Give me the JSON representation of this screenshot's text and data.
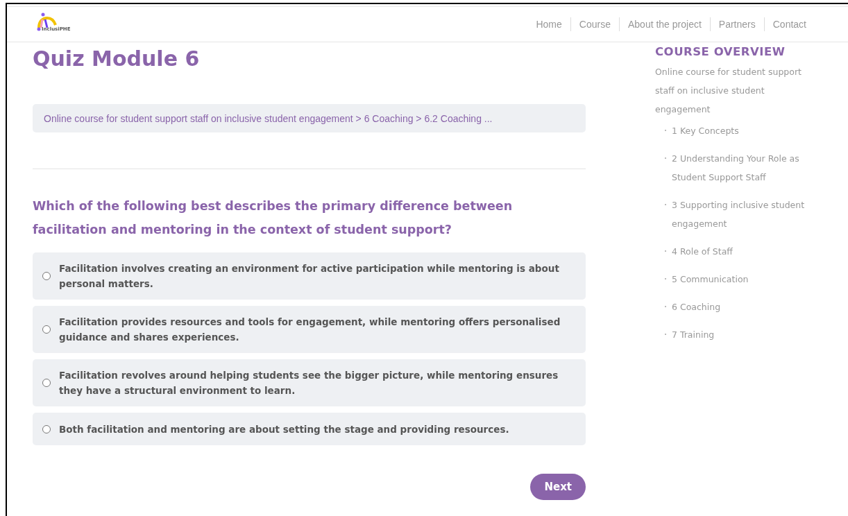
{
  "header": {
    "logo_text": "InclusiPHE",
    "nav": [
      {
        "label": "Home"
      },
      {
        "label": "Course"
      },
      {
        "label": "About the project"
      },
      {
        "label": "Partners"
      },
      {
        "label": "Contact"
      }
    ]
  },
  "title": "Quiz Module 6",
  "breadcrumb": "Online course for student support staff on inclusive student engagement > 6 Coaching  > 6.2 Coaching ...",
  "question": "Which of the following best describes the primary difference between facilitation and mentoring in the context of student support?",
  "options": [
    {
      "text": "Facilitation involves creating an environment for active participation while mentoring is about personal matters.",
      "selected": false
    },
    {
      "text": "Facilitation provides resources and tools for engagement, while mentoring offers personalised guidance and shares experiences.",
      "selected": false
    },
    {
      "text": "Facilitation revolves around helping students see the bigger picture, while mentoring ensures they have a structural environment to learn.",
      "selected": false
    },
    {
      "text": "Both facilitation and mentoring are about setting the stage and providing resources.",
      "selected": false
    }
  ],
  "next_button": "Next",
  "sidebar": {
    "heading": "COURSE OVERVIEW",
    "course": "Online course for student support staff on inclusive student engagement",
    "items": [
      {
        "label": "1 Key Concepts"
      },
      {
        "label": "2 Understanding Your Role as Student Support Staff"
      },
      {
        "label": "3 Supporting inclusive student engagement"
      },
      {
        "label": "4 Role of Staff"
      },
      {
        "label": "5 Communication"
      },
      {
        "label": "6 Coaching"
      },
      {
        "label": "7 Training"
      }
    ]
  }
}
